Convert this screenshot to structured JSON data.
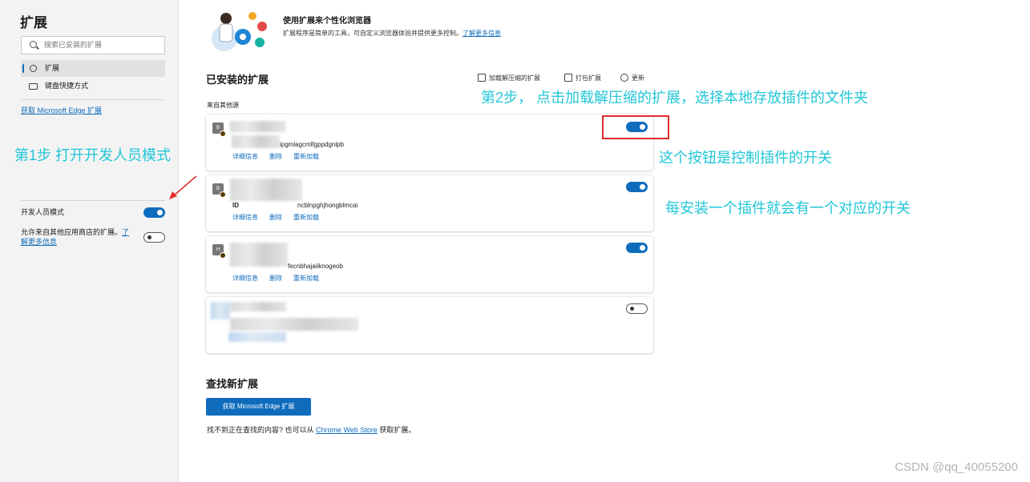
{
  "sidebar": {
    "title": "扩展",
    "search_placeholder": "搜索已安装的扩展",
    "items": [
      {
        "label": "扩展"
      },
      {
        "label": "键盘快捷方式"
      }
    ],
    "get_link": "获取 Microsoft Edge 扩展",
    "dev_mode_label": "开发人员模式",
    "dev_mode_on": true,
    "allow_text": "允许来自其他应用商店的扩展。",
    "allow_link_1": "了",
    "allow_link_2": "解更多信息",
    "allow_on": false
  },
  "hero": {
    "title": "使用扩展来个性化浏览器",
    "desc": "扩展程序是简单的工具，可自定义浏览器体验并提供更多控制。",
    "link": "了解更多信息"
  },
  "installed": {
    "title": "已安装的扩展",
    "source_label": "来自其他源",
    "toolbar": {
      "load_unpacked": "加载解压缩的扩展",
      "pack": "打包扩展",
      "update": "更新"
    },
    "extensions": [
      {
        "icon_letter": "B",
        "id_visible": "ipgmlagcmlfgppdgnlpb",
        "enabled": true,
        "links": [
          "详细信息",
          "删除",
          "重新加载"
        ]
      },
      {
        "icon_letter": "B",
        "id_prefix": "ID",
        "id_visible": "ncblnpghjhongblmcai",
        "enabled": true,
        "links": [
          "详细信息",
          "删除",
          "重新加载"
        ]
      },
      {
        "icon_letter": "H",
        "id_visible": "fecnbhajaiiknogeob",
        "enabled": true,
        "links": [
          "详细信息",
          "删除",
          "重新加载"
        ]
      },
      {
        "enabled": false
      }
    ]
  },
  "find": {
    "title": "查找新扩展",
    "button": "获取 Microsoft Edge 扩展",
    "footer_prefix": "找不到正在查找的内容? 也可以从 ",
    "footer_link": "Chrome Web Store",
    "footer_suffix": " 获取扩展。"
  },
  "annotations": {
    "step1": "第1步 打开开发人员模式",
    "step2": "第2步， 点击加载解压缩的扩展，选择本地存放插件的文件夹",
    "toggle_note": "这个按钮是控制插件的开关",
    "each_note": "每安装一个插件就会有一个对应的开关",
    "color": "#21c6d8",
    "arrow_color": "#e32b2b"
  },
  "watermark": "CSDN @qq_40055200",
  "colors": {
    "accent": "#0f6cbd"
  }
}
